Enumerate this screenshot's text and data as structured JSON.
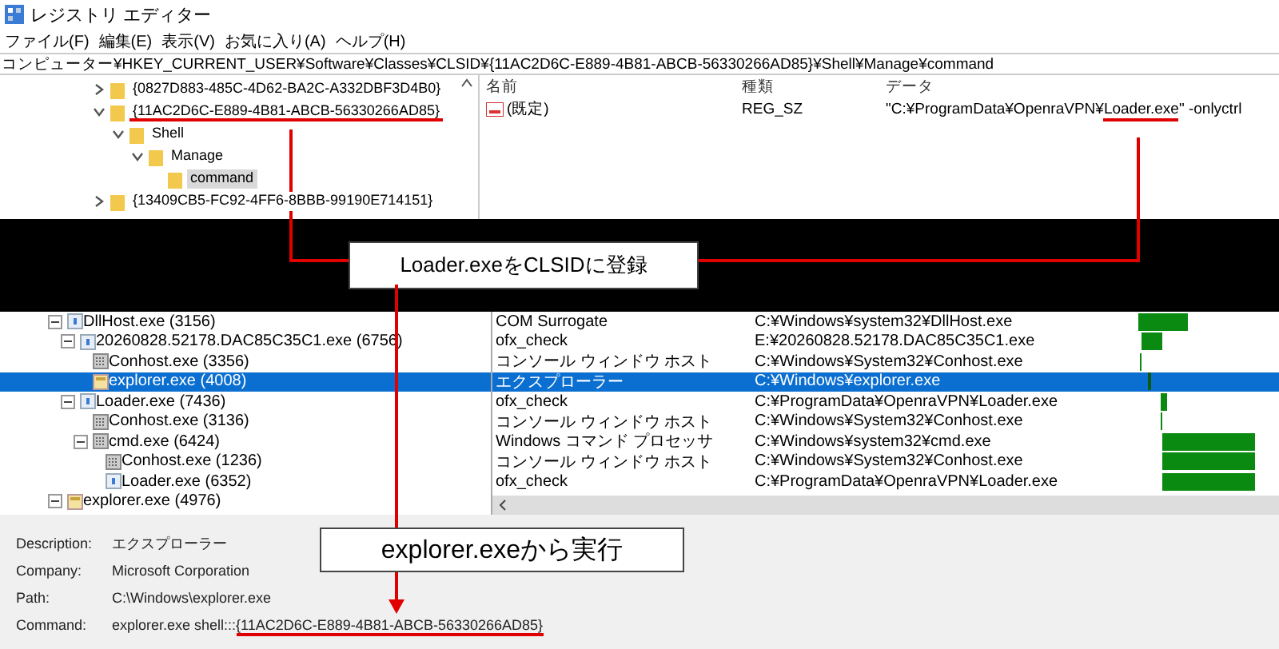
{
  "registry_editor": {
    "title": "レジストリ エディター",
    "menu": [
      "ファイル(F)",
      "編集(E)",
      "表示(V)",
      "お気に入り(A)",
      "ヘルプ(H)"
    ],
    "address": "コンピューター¥HKEY_CURRENT_USER¥Software¥Classes¥CLSID¥{11AC2D6C-E889-4B81-ABCB-56330266AD85}¥Shell¥Manage¥command",
    "tree": [
      {
        "label": "{0827D883-485C-4D62-BA2C-A332DBF3D4B0}",
        "expanded": false,
        "selected": false,
        "underlined": false
      },
      {
        "label": "{11AC2D6C-E889-4B81-ABCB-56330266AD85}",
        "expanded": true,
        "selected": false,
        "underlined": true,
        "children": [
          {
            "label": "Shell",
            "expanded": true,
            "selected": false,
            "underlined": false,
            "children": [
              {
                "label": "Manage",
                "expanded": true,
                "selected": false,
                "underlined": false,
                "children": [
                  {
                    "label": "command",
                    "selected": true,
                    "underlined": false
                  }
                ]
              }
            ]
          }
        ]
      },
      {
        "label": "{13409CB5-FC92-4FF6-8BBB-99190E714151}",
        "expanded": false,
        "selected": false,
        "underlined": false
      }
    ],
    "columns": [
      "名前",
      "種類",
      "データ"
    ],
    "values": [
      {
        "name": "(既定)",
        "type": "REG_SZ",
        "data": {
          "before": "\"C:¥ProgramData¥OpenraVPN¥",
          "highlight": "Loader.exe",
          "after": "\" -onlyctrl"
        }
      }
    ]
  },
  "callout_top": "Loader.exeをCLSIDに登録",
  "process_list": {
    "rows": [
      {
        "name": "DllHost.exe (3156)",
        "kind": "app",
        "expanded": true,
        "selected": false,
        "description": "COM Surrogate",
        "path": "C:¥Windows¥system32¥DllHost.exe",
        "children": [
          {
            "name": "20260828.52178.DAC85C35C1.exe (6756)",
            "kind": "app",
            "expanded": true,
            "selected": false,
            "description": "ofx_check",
            "path": "E:¥20260828.52178.DAC85C35C1.exe",
            "children": [
              {
                "name": "Conhost.exe (3356)",
                "kind": "console",
                "selected": false,
                "description": "コンソール ウィンドウ ホスト",
                "path": "C:¥Windows¥System32¥Conhost.exe"
              },
              {
                "name": "explorer.exe (4008)",
                "kind": "explorer",
                "selected": true,
                "description": "エクスプローラー",
                "path": "C:¥Windows¥explorer.exe"
              }
            ]
          },
          {
            "name": "Loader.exe (7436)",
            "kind": "app",
            "expanded": true,
            "selected": false,
            "description": "ofx_check",
            "path": "C:¥ProgramData¥OpenraVPN¥Loader.exe",
            "children": [
              {
                "name": "Conhost.exe (3136)",
                "kind": "console",
                "selected": false,
                "description": "コンソール ウィンドウ ホスト",
                "path": "C:¥Windows¥System32¥Conhost.exe"
              },
              {
                "name": "cmd.exe (6424)",
                "kind": "console",
                "expanded": true,
                "selected": false,
                "description": "Windows コマンド プロセッサ",
                "path": "C:¥Windows¥system32¥cmd.exe",
                "children": [
                  {
                    "name": "Conhost.exe (1236)",
                    "kind": "console",
                    "selected": false,
                    "description": "コンソール ウィンドウ ホスト",
                    "path": "C:¥Windows¥System32¥Conhost.exe"
                  },
                  {
                    "name": "Loader.exe (6352)",
                    "kind": "app",
                    "selected": false,
                    "description": "ofx_check",
                    "path": "C:¥ProgramData¥OpenraVPN¥Loader.exe"
                  }
                ]
              }
            ]
          }
        ]
      },
      {
        "name": "explorer.exe (4976)",
        "kind": "explorer",
        "expanded": true,
        "selected": false
      }
    ]
  },
  "details": [
    {
      "label": "Description:",
      "value": "エクスプローラー"
    },
    {
      "label": "Company:",
      "value": "Microsoft Corporation"
    },
    {
      "label": "Path:",
      "value": "C:\\Windows\\explorer.exe"
    },
    {
      "label": "Command:",
      "value": "explorer.exe shell:::",
      "highlight": "{11AC2D6C-E889-4B81-ABCB-56330266AD85}"
    }
  ],
  "callout_bottom": "explorer.exeから実行"
}
